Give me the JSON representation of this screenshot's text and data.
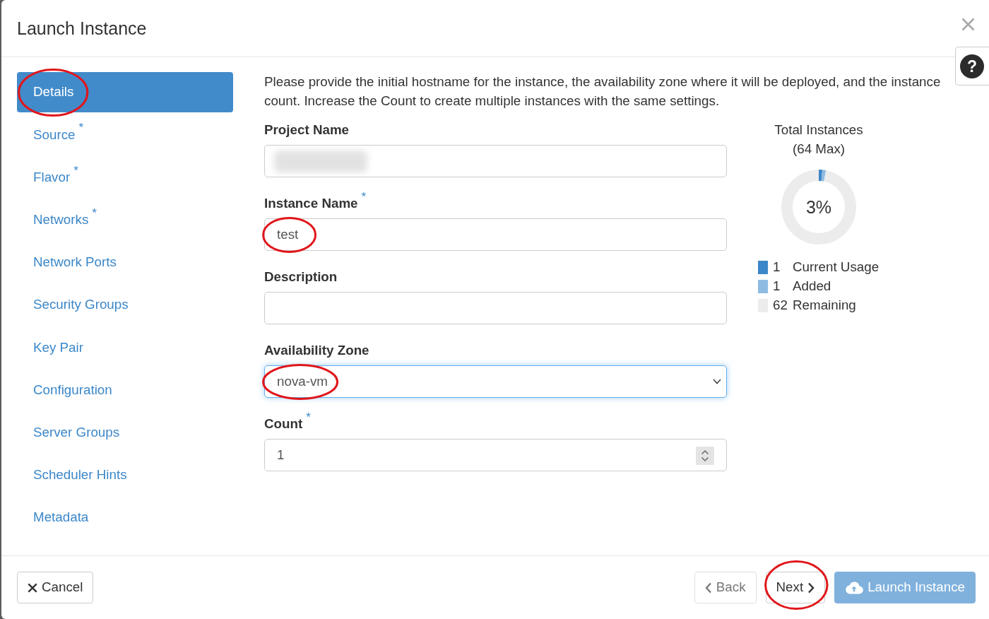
{
  "window": {
    "title": "Launch Instance"
  },
  "help_button": {
    "label": "?"
  },
  "sidebar": {
    "items": [
      {
        "label": "Details",
        "selected": true,
        "circled": true
      },
      {
        "label": "Source",
        "required_mark": "*",
        "selected": false,
        "circled": false
      },
      {
        "label": "Flavor",
        "required_mark": "*",
        "selected": false,
        "circled": false
      },
      {
        "label": "Networks",
        "required_mark": "*",
        "selected": false,
        "circled": false
      },
      {
        "label": "Network Ports",
        "selected": false,
        "circled": false
      },
      {
        "label": "Security Groups",
        "selected": false,
        "circled": false
      },
      {
        "label": "Key Pair",
        "selected": false,
        "circled": false
      },
      {
        "label": "Configuration",
        "selected": false,
        "circled": false
      },
      {
        "label": "Server Groups",
        "selected": false,
        "circled": false
      },
      {
        "label": "Scheduler Hints",
        "selected": false,
        "circled": false
      },
      {
        "label": "Metadata",
        "selected": false,
        "circled": false
      }
    ]
  },
  "intro": "Please provide the initial hostname for the instance, the availability zone where it will be deployed, and the instance count. Increase the Count to create multiple instances with the same settings.",
  "fields": [
    {
      "kind": "text",
      "label": "Project Name",
      "redacted": true,
      "focused": false,
      "circled": false
    },
    {
      "kind": "text",
      "label": "Instance Name",
      "required_mark": "*",
      "value": "test",
      "redacted": false,
      "focused": false,
      "circled": true
    },
    {
      "kind": "text",
      "label": "Description",
      "redacted": false,
      "focused": false,
      "circled": false
    },
    {
      "kind": "select",
      "label": "Availability Zone",
      "value": "nova-vm",
      "redacted": false,
      "focused": true,
      "circled": true
    },
    {
      "kind": "number",
      "label": "Count",
      "required_mark": "*",
      "value": "1",
      "redacted": false,
      "focused": false,
      "circled": false
    }
  ],
  "quota": {
    "max_label": "(64 Max)",
    "center_label": "3%",
    "legend": [
      {
        "count": "1",
        "color": "#3c87c8"
      },
      {
        "count": "1",
        "color": "#8fbbe2"
      },
      {
        "count": "62",
        "color": "#ececec"
      }
    ],
    "chart_data": {
      "type": "donut",
      "title": "Total Instances",
      "categories": [
        "Current Usage",
        "Added",
        "Remaining"
      ],
      "values": [
        1.5625,
        1.5625,
        96.875
      ]
    }
  },
  "buttons": [
    {
      "kind": "cancel",
      "label": "Cancel",
      "disabled": false,
      "circled": false
    },
    {
      "kind": "back",
      "label": "Back",
      "disabled": true,
      "circled": false
    },
    {
      "kind": "next",
      "label": "Next",
      "disabled": false,
      "circled": true
    },
    {
      "kind": "launch",
      "label": "Launch Instance",
      "disabled": true,
      "circled": false
    }
  ]
}
